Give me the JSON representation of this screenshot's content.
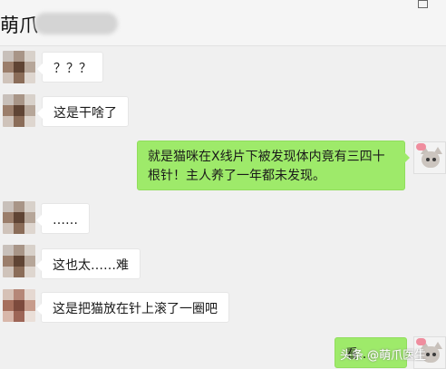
{
  "header": {
    "title": "萌爪"
  },
  "window_controls": {
    "pin": "⌃",
    "minimize": "—"
  },
  "messages": [
    {
      "from": "other",
      "text": "？？？"
    },
    {
      "from": "other",
      "text": "这是干啥了"
    },
    {
      "from": "self",
      "text": "就是猫咪在X线片下被发现体内竟有三四十根针！主人养了一年都未发现。"
    },
    {
      "from": "other",
      "text": "……"
    },
    {
      "from": "other",
      "text": "这也太……难"
    },
    {
      "from": "other",
      "text": "这是把猫放在针上滚了一圈吧"
    },
    {
      "from": "self",
      "text": "看…"
    }
  ],
  "watermark": "头条 @萌爪医生",
  "colors": {
    "self_bubble": "#9eea6a",
    "other_bubble": "#ffffff",
    "background": "#f0f0f0"
  }
}
